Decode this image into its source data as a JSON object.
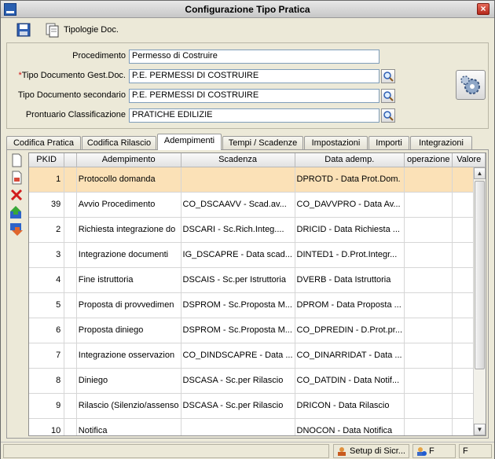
{
  "window": {
    "title": "Configurazione Tipo Pratica",
    "close_label": "×"
  },
  "toolbar": {
    "tipologie_label": "Tipologie Doc."
  },
  "form": {
    "procedimento": {
      "label": "Procedimento",
      "value": "Permesso di Costruire"
    },
    "tipo_doc": {
      "label": "Tipo Documento Gest.Doc.",
      "required_mark": "*",
      "value": "P.E. PERMESSI DI COSTRUIRE"
    },
    "tipo_doc_sec": {
      "label": "Tipo Documento secondario",
      "value": "P.E. PERMESSI DI COSTRUIRE"
    },
    "prontuario": {
      "label": "Prontuario Classificazione",
      "value": "PRATICHE EDILIZIE"
    }
  },
  "tabs": [
    {
      "label": "Codifica Pratica"
    },
    {
      "label": "Codifica Rilascio"
    },
    {
      "label": "Adempimenti"
    },
    {
      "label": "Tempi / Scadenze"
    },
    {
      "label": "Impostazioni"
    },
    {
      "label": "Importi"
    },
    {
      "label": "Integrazioni"
    }
  ],
  "active_tab": "Adempimenti",
  "grid": {
    "columns": [
      "PKID",
      "",
      "Adempimento",
      "Scadenza",
      "Data ademp.",
      "operazione",
      "Valore"
    ],
    "rows": [
      {
        "pkid": "1",
        "adempimento": "Protocollo domanda",
        "scadenza": "",
        "data": "DPROTD - Data Prot.Dom."
      },
      {
        "pkid": "39",
        "adempimento": "Avvio Procedimento",
        "scadenza": "CO_DSCAAVV - Scad.av...",
        "data": "CO_DAVVPRO - Data Av..."
      },
      {
        "pkid": "2",
        "adempimento": "Richiesta integrazione do",
        "scadenza": "DSCARI - Sc.Rich.Integ....",
        "data": "DRICID - Data Richiesta ..."
      },
      {
        "pkid": "3",
        "adempimento": "Integrazione documenti",
        "scadenza": "IG_DSCAPRE - Data scad...",
        "data": "DINTED1 - D.Prot.Integr..."
      },
      {
        "pkid": "4",
        "adempimento": "Fine istruttoria",
        "scadenza": "DSCAIS - Sc.per Istruttoria",
        "data": "DVERB - Data Istruttoria"
      },
      {
        "pkid": "5",
        "adempimento": "Proposta di provvedimen",
        "scadenza": "DSPROM - Sc.Proposta M...",
        "data": "DPROM - Data Proposta ..."
      },
      {
        "pkid": "6",
        "adempimento": "Proposta diniego",
        "scadenza": "DSPROM - Sc.Proposta M...",
        "data": "CO_DPREDIN - D.Prot.pr..."
      },
      {
        "pkid": "7",
        "adempimento": "Integrazione osservazion",
        "scadenza": "CO_DINDSCAPRE - Data ...",
        "data": "CO_DINARRIDAT - Data ..."
      },
      {
        "pkid": "8",
        "adempimento": "Diniego",
        "scadenza": "DSCASA - Sc.per Rilascio",
        "data": "CO_DATDIN - Data Notif..."
      },
      {
        "pkid": "9",
        "adempimento": "Rilascio (Silenzio/assenso",
        "scadenza": "DSCASA - Sc.per Rilascio",
        "data": "DRICON - Data Rilascio"
      },
      {
        "pkid": "10",
        "adempimento": "Notifica",
        "scadenza": "",
        "data": "DNOCON - Data Notifica"
      }
    ]
  },
  "statusbar": {
    "setup_label": "Setup di Sicr...",
    "user_flag": "F",
    "end_flag": "F"
  }
}
